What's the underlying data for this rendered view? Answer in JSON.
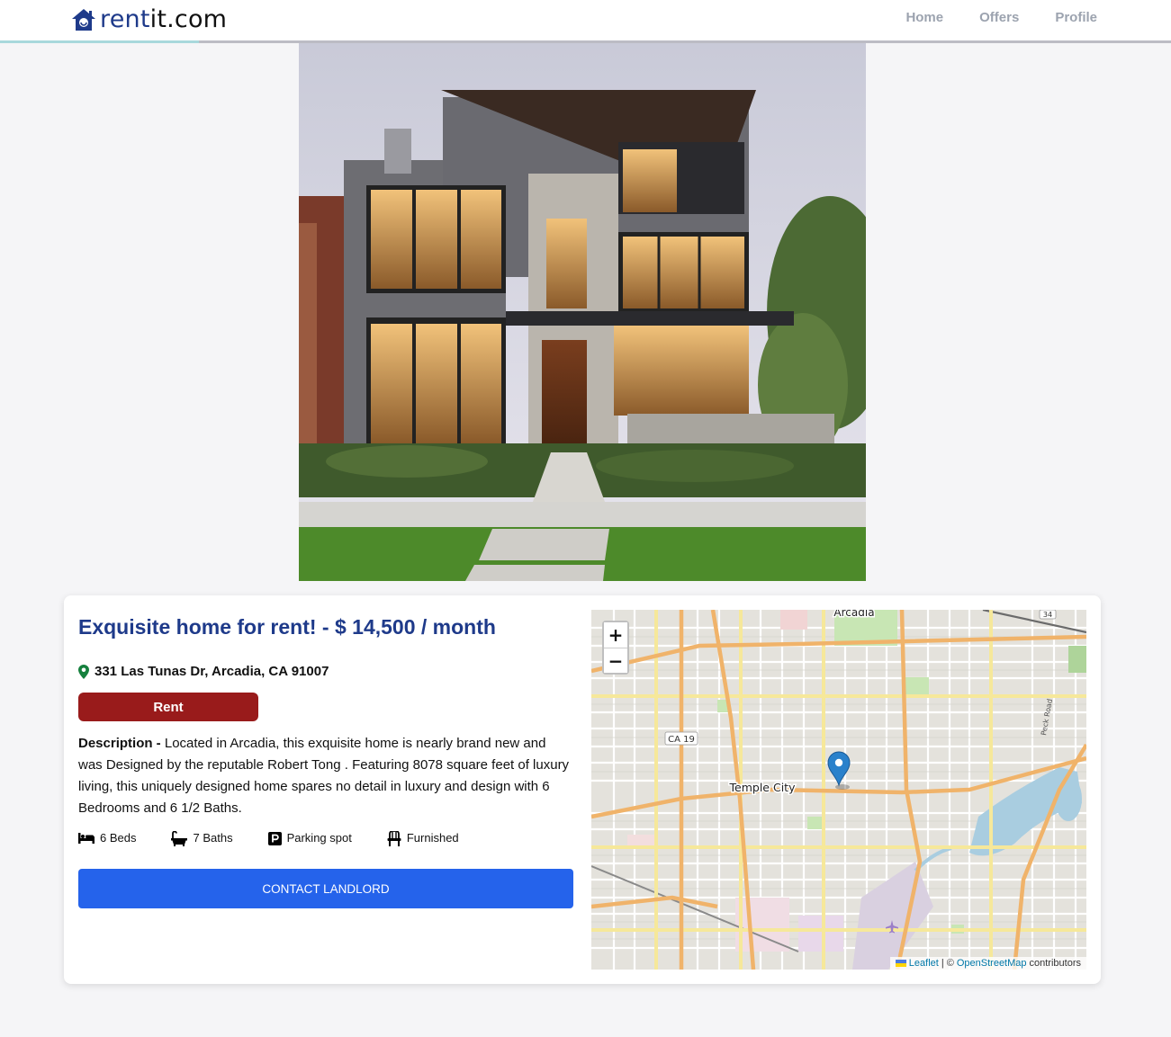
{
  "header": {
    "logo_part1": "rent",
    "logo_part2": "it.com",
    "nav": [
      {
        "label": "Home"
      },
      {
        "label": "Offers"
      },
      {
        "label": "Profile"
      }
    ],
    "scroll_progress": 0.17,
    "colors": {
      "brand": "#1e3a8a",
      "nav": "#9ca3af",
      "progress": "#a8d8dc"
    }
  },
  "hero": {
    "icon": "house-photo"
  },
  "listing": {
    "title": "Exquisite home for rent! - $ 14,500 / month",
    "address": "331 Las Tunas Dr, Arcadia, CA 91007",
    "type_badge": "Rent",
    "description_label": "Description - ",
    "description": "Located in Arcadia, this exquisite home is nearly brand new and was Designed by the reputable Robert Tong . Featuring 8078 square feet of luxury living, this uniquely designed home spares no detail in luxury and design with 6 Bedrooms and 6 1/2 Baths.",
    "features": [
      {
        "icon": "bed-icon",
        "label": "6 Beds"
      },
      {
        "icon": "bath-icon",
        "label": "7 Baths"
      },
      {
        "icon": "parking-icon",
        "label": "Parking spot"
      },
      {
        "icon": "chair-icon",
        "label": "Furnished"
      }
    ],
    "contact_label": "Contact Landlord",
    "colors": {
      "title": "#1e3a8a",
      "badge": "#991b1b",
      "button": "#2563eb"
    }
  },
  "map": {
    "zoom_in": "+",
    "zoom_out": "−",
    "labels": {
      "arcadia": "Arcadia",
      "temple_city": "Temple City",
      "ca19": "CA 19",
      "peck_road": "Peck Road",
      "route34": "34"
    },
    "attribution": {
      "leaflet": "Leaflet",
      "separator": "| ©",
      "osm": "OpenStreetMap",
      "contributors": "contributors"
    }
  }
}
